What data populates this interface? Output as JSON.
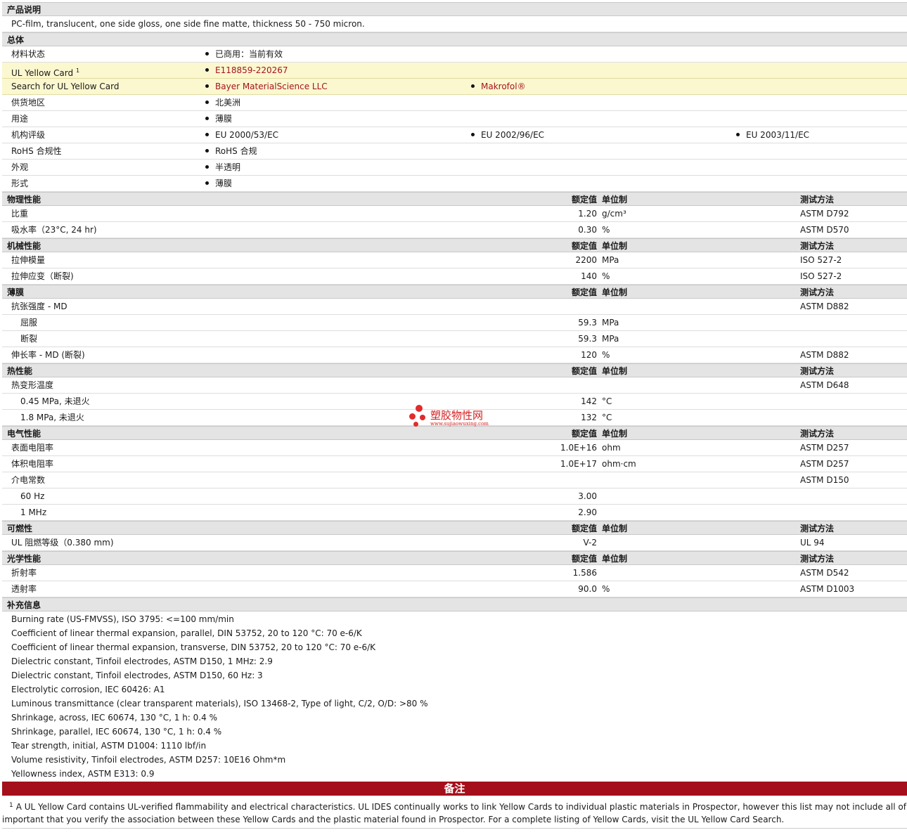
{
  "sections": {
    "desc": {
      "title": "产品说明",
      "text": "PC-film, translucent, one side gloss, one side fine matte, thickness 50 - 750 micron."
    },
    "general": {
      "title": "总体"
    },
    "physical": {
      "title": "物理性能"
    },
    "mechanical": {
      "title": "机械性能"
    },
    "film": {
      "title": "薄膜"
    },
    "thermal": {
      "title": "热性能"
    },
    "electrical": {
      "title": "电气性能"
    },
    "flammability": {
      "title": "可燃性"
    },
    "optical": {
      "title": "光学性能"
    },
    "supplemental": {
      "title": "补充信息"
    }
  },
  "headers": {
    "value": "额定值",
    "unit": "单位制",
    "method": "测试方法"
  },
  "general": {
    "status": {
      "label": "材料状态",
      "b1": "已商用：当前有效"
    },
    "ulcard": {
      "label": "UL Yellow Card",
      "sup": "1",
      "b1": "E118859-220267"
    },
    "ulsearch": {
      "label": "Search for UL Yellow Card",
      "b1": "Bayer MaterialScience LLC",
      "b2": "Makrofol®"
    },
    "region": {
      "label": "供货地区",
      "b1": "北美洲"
    },
    "use": {
      "label": "用途",
      "b1": "薄膜"
    },
    "agency": {
      "label": "机构评级",
      "b1": "EU 2000/53/EC",
      "b2": "EU 2002/96/EC",
      "b3": "EU 2003/11/EC"
    },
    "rohs": {
      "label": "RoHS 合规性",
      "b1": "RoHS 合规"
    },
    "appearance": {
      "label": "外观",
      "b1": "半透明"
    },
    "form": {
      "label": "形式",
      "b1": "薄膜"
    }
  },
  "physical": [
    {
      "label": "比重",
      "value": "1.20",
      "unit": "g/cm³",
      "method": "ASTM D792"
    },
    {
      "label": "吸水率（23°C, 24 hr)",
      "value": "0.30",
      "unit": "%",
      "method": "ASTM D570"
    }
  ],
  "mechanical": [
    {
      "label": "拉伸模量",
      "value": "2200",
      "unit": "MPa",
      "method": "ISO 527-2"
    },
    {
      "label": "拉伸应变（断裂)",
      "value": "140",
      "unit": "%",
      "method": "ISO 527-2"
    }
  ],
  "film": [
    {
      "label": "抗张强度 - MD",
      "value": "",
      "unit": "",
      "method": "ASTM D882"
    },
    {
      "label": "屈服",
      "value": "59.3",
      "unit": "MPa",
      "method": ""
    },
    {
      "label": "断裂",
      "value": "59.3",
      "unit": "MPa",
      "method": ""
    },
    {
      "label": "伸长率 - MD (断裂)",
      "value": "120",
      "unit": "%",
      "method": "ASTM D882"
    }
  ],
  "thermal": [
    {
      "label": "热变形温度",
      "value": "",
      "unit": "",
      "method": "ASTM D648"
    },
    {
      "label": "0.45 MPa, 未退火",
      "value": "142",
      "unit": "°C",
      "method": ""
    },
    {
      "label": "1.8 MPa, 未退火",
      "value": "132",
      "unit": "°C",
      "method": ""
    }
  ],
  "electrical": [
    {
      "label": "表面电阻率",
      "value": "1.0E+16",
      "unit": "ohm",
      "method": "ASTM D257"
    },
    {
      "label": "体积电阻率",
      "value": "1.0E+17",
      "unit": "ohm·cm",
      "method": "ASTM D257"
    },
    {
      "label": "介电常数",
      "value": "",
      "unit": "",
      "method": "ASTM D150"
    },
    {
      "label": "60 Hz",
      "value": "3.00",
      "unit": "",
      "method": ""
    },
    {
      "label": "1 MHz",
      "value": "2.90",
      "unit": "",
      "method": ""
    }
  ],
  "flammability": [
    {
      "label": "UL 阻燃等级（0.380 mm)",
      "value": "V-2",
      "unit": "",
      "method": "UL 94"
    }
  ],
  "optical": [
    {
      "label": "折射率",
      "value": "1.586",
      "unit": "",
      "method": "ASTM D542"
    },
    {
      "label": "透射率",
      "value": "90.0",
      "unit": "%",
      "method": "ASTM D1003"
    }
  ],
  "supplemental": [
    "Burning rate (US-FMVSS), ISO 3795: <=100 mm/min",
    "Coefficient of linear thermal expansion, parallel, DIN 53752, 20 to 120 °C: 70 e-6/K",
    "Coefficient of linear thermal expansion, transverse, DIN 53752, 20 to 120 °C: 70 e-6/K",
    "Dielectric constant, Tinfoil electrodes, ASTM D150, 1 MHz: 2.9",
    "Dielectric constant, Tinfoil electrodes, ASTM D150, 60 Hz: 3",
    "Electrolytic corrosion, IEC 60426: A1",
    "Luminous transmittance (clear transparent materials), ISO 13468-2, Type of light, C/2, O/D: >80 %",
    "Shrinkage, across, IEC 60674, 130 °C, 1 h: 0.4 %",
    "Shrinkage, parallel, IEC 60674, 130 °C, 1 h: 0.4 %",
    "Tear strength, initial, ASTM D1004: 1110 lbf/in",
    "Volume resistivity, Tinfoil electrodes, ASTM D257: 10E16 Ohm*m",
    "Yellowness index, ASTM E313: 0.9"
  ],
  "notes": {
    "title": "备注",
    "sup": "1",
    "line1": "A UL Yellow Card contains UL-verified flammability and electrical characteristics. UL IDES continually works to link Yellow Cards to individual plastic materials in Prospector, however this list may not include all of the app",
    "line2": "important that you verify the association between these Yellow Cards and the plastic material found in Prospector. For a complete listing of Yellow Cards, visit the UL Yellow Card Search."
  },
  "watermark": {
    "title": "塑胶物性网",
    "url": "www.sujiaowuxing.com",
    "color": "#d42020"
  }
}
